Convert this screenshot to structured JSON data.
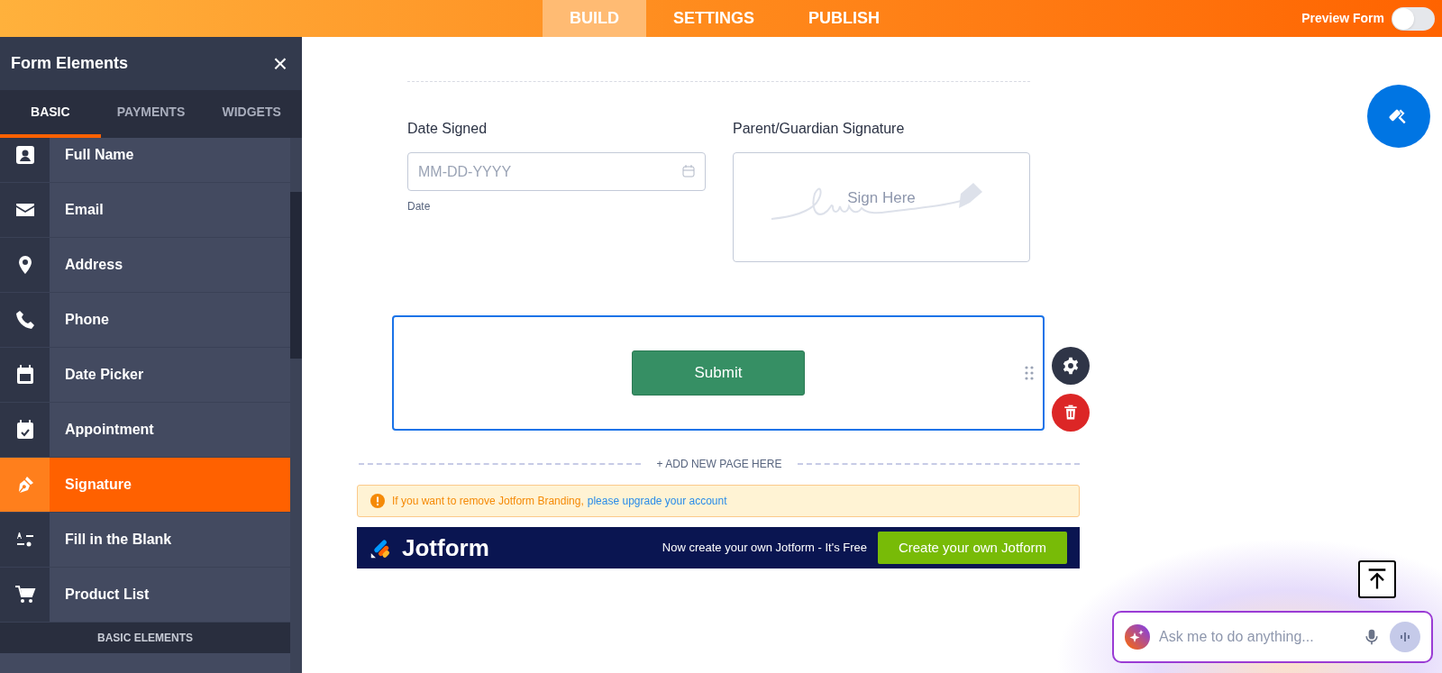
{
  "top_tabs": [
    {
      "label": "BUILD",
      "selected": true
    },
    {
      "label": "SETTINGS",
      "selected": false
    },
    {
      "label": "PUBLISH",
      "selected": false
    }
  ],
  "preview": {
    "label": "Preview Form",
    "on": false
  },
  "sidebar": {
    "title": "Form Elements",
    "close": "×",
    "tabs": [
      {
        "label": "BASIC",
        "selected": true
      },
      {
        "label": "PAYMENTS",
        "selected": false
      },
      {
        "label": "WIDGETS",
        "selected": false
      }
    ],
    "items": [
      {
        "kind": "element",
        "label": "Full Name",
        "selected": false
      },
      {
        "kind": "element",
        "label": "Email",
        "selected": false
      },
      {
        "kind": "element",
        "label": "Address",
        "selected": false
      },
      {
        "kind": "element",
        "label": "Phone",
        "selected": false
      },
      {
        "kind": "element",
        "label": "Date Picker",
        "selected": false
      },
      {
        "kind": "element",
        "label": "Appointment",
        "selected": false
      },
      {
        "kind": "element",
        "label": "Signature",
        "selected": true
      },
      {
        "kind": "element",
        "label": "Fill in the Blank",
        "selected": false
      },
      {
        "kind": "element",
        "label": "Product List",
        "selected": false
      },
      {
        "kind": "heading",
        "label": "BASIC ELEMENTS"
      }
    ]
  },
  "form": {
    "fields": [
      {
        "kind": "date",
        "label": "Date Signed",
        "placeholder": "MM-DD-YYYY",
        "sublabel": "Date"
      },
      {
        "kind": "signature",
        "label": "Parent/Guardian Signature",
        "hint": "Sign Here"
      }
    ],
    "submit": "Submit",
    "add_page": "+ ADD NEW PAGE HERE",
    "notice": {
      "text": "If you want to remove Jotform Branding,",
      "link": "please upgrade your account"
    },
    "branding": {
      "logo": "Jotform",
      "tagline": "Now create your own Jotform - It's Free",
      "button": "Create your own Jotform"
    }
  },
  "assistant": {
    "placeholder": "Ask me to do anything..."
  }
}
